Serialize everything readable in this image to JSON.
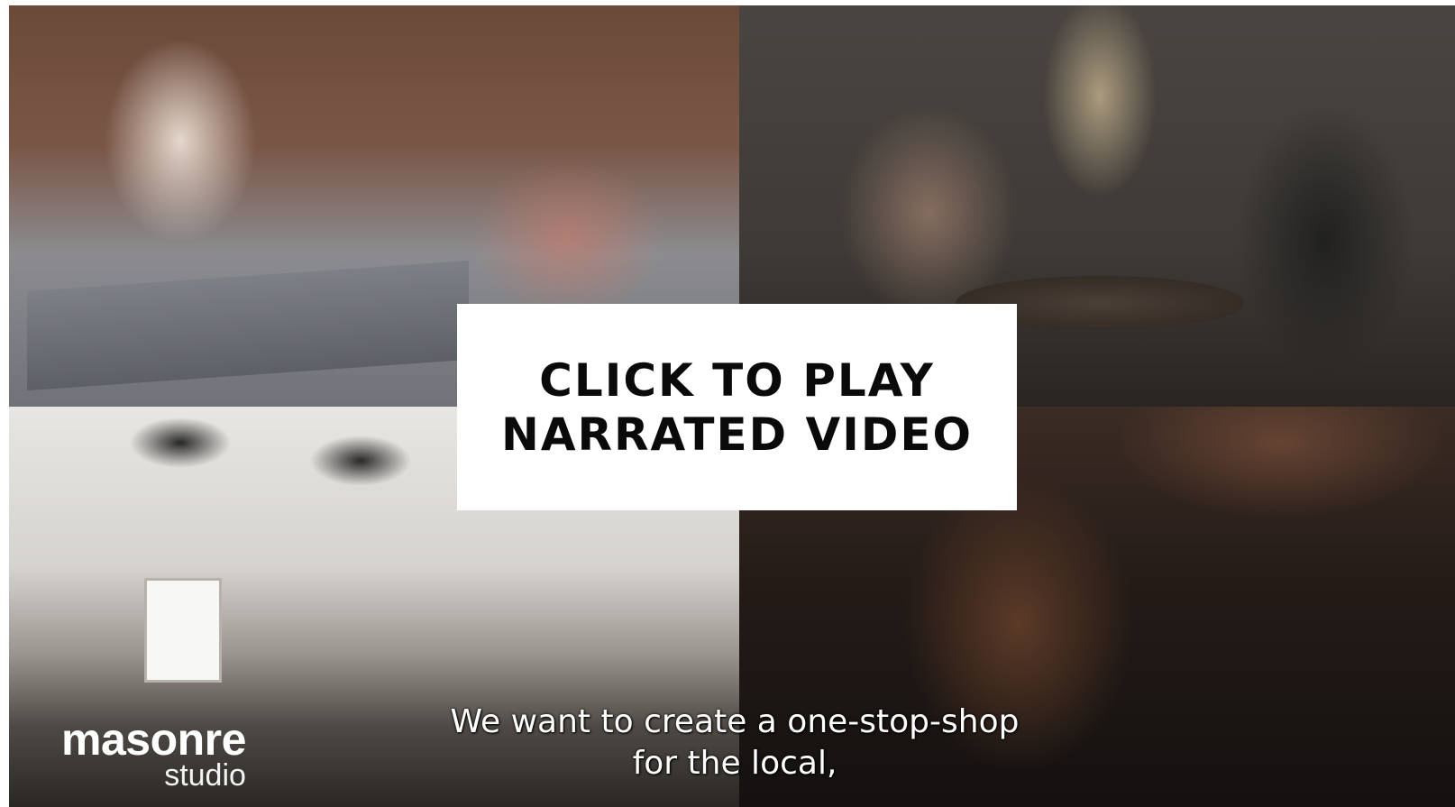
{
  "cta": {
    "line1": "CLICK TO PLAY",
    "line2": "NARRATED VIDEO"
  },
  "logo": {
    "main": "masonre",
    "sub": "studio"
  },
  "subtitles": {
    "line1": "We want to create a one-stop-shop",
    "line2": "for the local,"
  }
}
